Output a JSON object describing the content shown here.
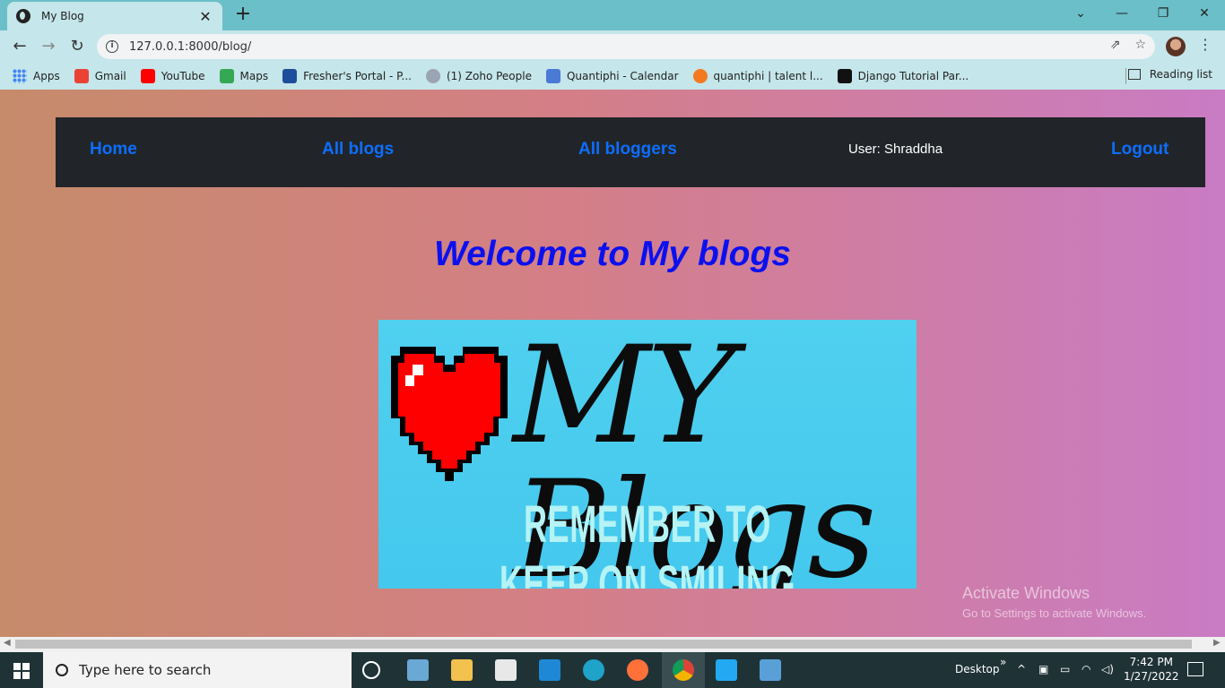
{
  "browser": {
    "tab_title": "My Blog",
    "tab_close": "✕",
    "new_tab": "+",
    "window_controls": [
      "⌄",
      "—",
      "❐",
      "✕"
    ],
    "url": "127.0.0.1:8000/blog/",
    "bookmarks": [
      {
        "label": "Apps",
        "color": "#4285f4"
      },
      {
        "label": "Gmail",
        "color": "#ea4335"
      },
      {
        "label": "YouTube",
        "color": "#ff0000"
      },
      {
        "label": "Maps",
        "color": "#34a853"
      },
      {
        "label": "Fresher's Portal - P...",
        "color": "#1e4e9a"
      },
      {
        "label": "(1) Zoho People",
        "color": "#9aa4b2"
      },
      {
        "label": "Quantiphi - Calendar",
        "color": "#4a79d6"
      },
      {
        "label": "quantiphi | talent l...",
        "color": "#f47a20"
      },
      {
        "label": "Django Tutorial Par...",
        "color": "#111111"
      }
    ],
    "reading_list": "Reading list"
  },
  "page": {
    "nav": {
      "home": "Home",
      "all_blogs": "All blogs",
      "all_bloggers": "All bloggers",
      "user": "User: Shraddha",
      "logout": "Logout"
    },
    "welcome": "Welcome to My blogs",
    "banner": {
      "logo_text": "MY Blogs",
      "tagline": "REMEMBER TO KEEP ON SMILING"
    },
    "watermark": {
      "line1": "Activate Windows",
      "line2": "Go to Settings to activate Windows."
    }
  },
  "taskbar": {
    "search_placeholder": "Type here to search",
    "desktop_label": "Desktop",
    "time": "7:42 PM",
    "date": "1/27/2022"
  },
  "colors": {
    "nav_bg": "#212529",
    "link": "#0d6efd",
    "welcome": "#0b10ef",
    "banner_bg": "#4fd0ef"
  }
}
